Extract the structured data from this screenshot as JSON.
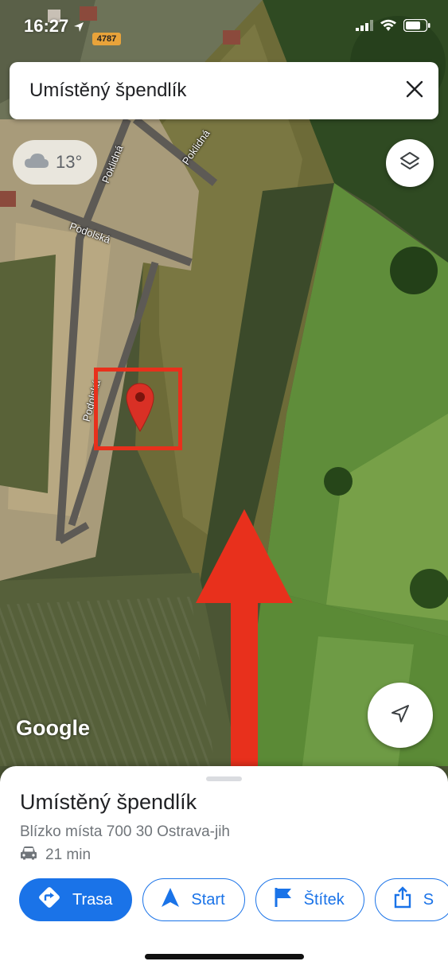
{
  "status_bar": {
    "time": "16:27",
    "road_number": "4787"
  },
  "search": {
    "title": "Umístěný špendlík"
  },
  "weather": {
    "temperature": "13°"
  },
  "map": {
    "streets": [
      "Poklidná",
      "Poklidná",
      "Podolská",
      "Podolská"
    ],
    "attribution": "Google",
    "annotation_color": "#e8301c"
  },
  "place": {
    "title": "Umístěný špendlík",
    "address": "Blízko místa 700 30 Ostrava-jih",
    "drive_time": "21 min"
  },
  "actions": [
    {
      "label": "Trasa",
      "icon": "directions-icon"
    },
    {
      "label": "Start",
      "icon": "navigation-arrow-icon"
    },
    {
      "label": "Štítek",
      "icon": "flag-icon"
    },
    {
      "label": "S",
      "icon": "share-icon"
    }
  ],
  "colors": {
    "accent": "#1a73e8",
    "pin": "#d93025"
  }
}
